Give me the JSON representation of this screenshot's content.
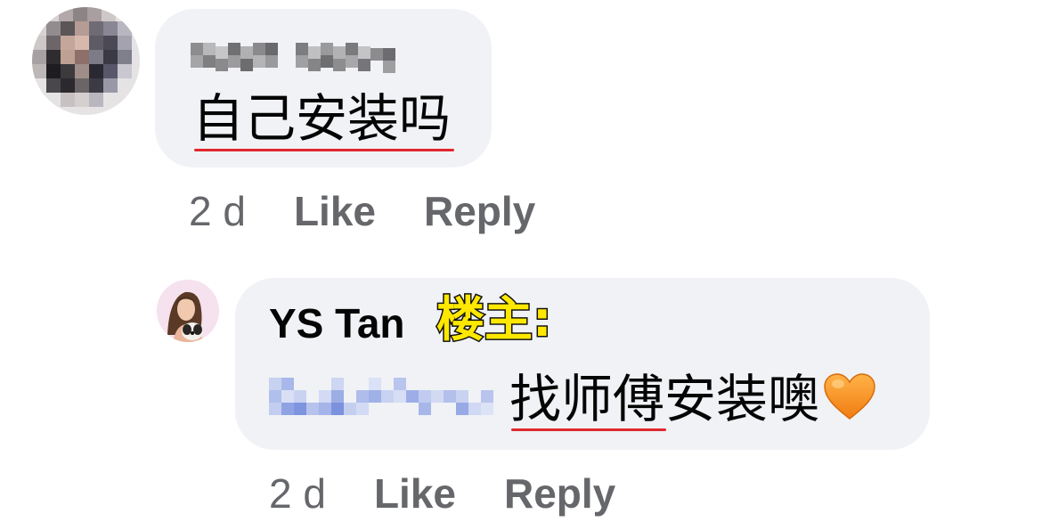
{
  "comments": [
    {
      "author_name": "",
      "text": "自己安装吗",
      "underlined_text": "自己安装吗",
      "timestamp": "2 d",
      "like_label": "Like",
      "reply_label": "Reply"
    },
    {
      "author_name": "YS Tan",
      "op_tag": "楼主:",
      "text": "找师傅安装噢",
      "underlined_text": "找师傅",
      "emoji": "orange-heart",
      "timestamp": "2 d",
      "like_label": "Like",
      "reply_label": "Reply"
    }
  ],
  "colors": {
    "bubble": "#f0f2f5",
    "meta_text": "#65676b",
    "body_text": "#050505",
    "underline": "#e0282e",
    "op_tag_fill": "#ffe800",
    "heart": "#f7931e"
  }
}
